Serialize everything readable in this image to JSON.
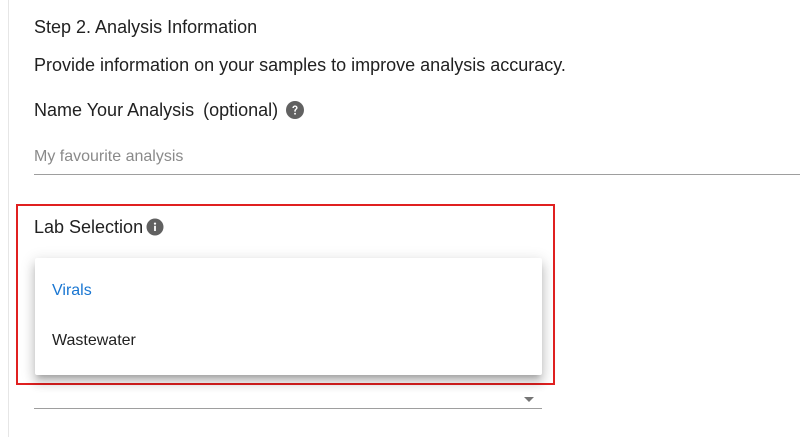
{
  "step": {
    "title": "Step 2. Analysis Information",
    "description": "Provide information on your samples to improve analysis accuracy."
  },
  "name_field": {
    "label": "Name Your Analysis",
    "optional_text": "(optional)",
    "placeholder": "My favourite analysis",
    "value": "",
    "help_icon": "help-circle-icon"
  },
  "lab_selection": {
    "label": "Lab Selection",
    "info_icon": "info-circle-icon",
    "highlight_color": "#e02020",
    "options": [
      {
        "label": "Virals",
        "highlighted": true
      },
      {
        "label": "Wastewater",
        "highlighted": false
      }
    ],
    "caret_icon": "arrow-drop-down-icon"
  },
  "colors": {
    "accent": "#1976d2",
    "text": "#212121",
    "icon": "#616161"
  }
}
